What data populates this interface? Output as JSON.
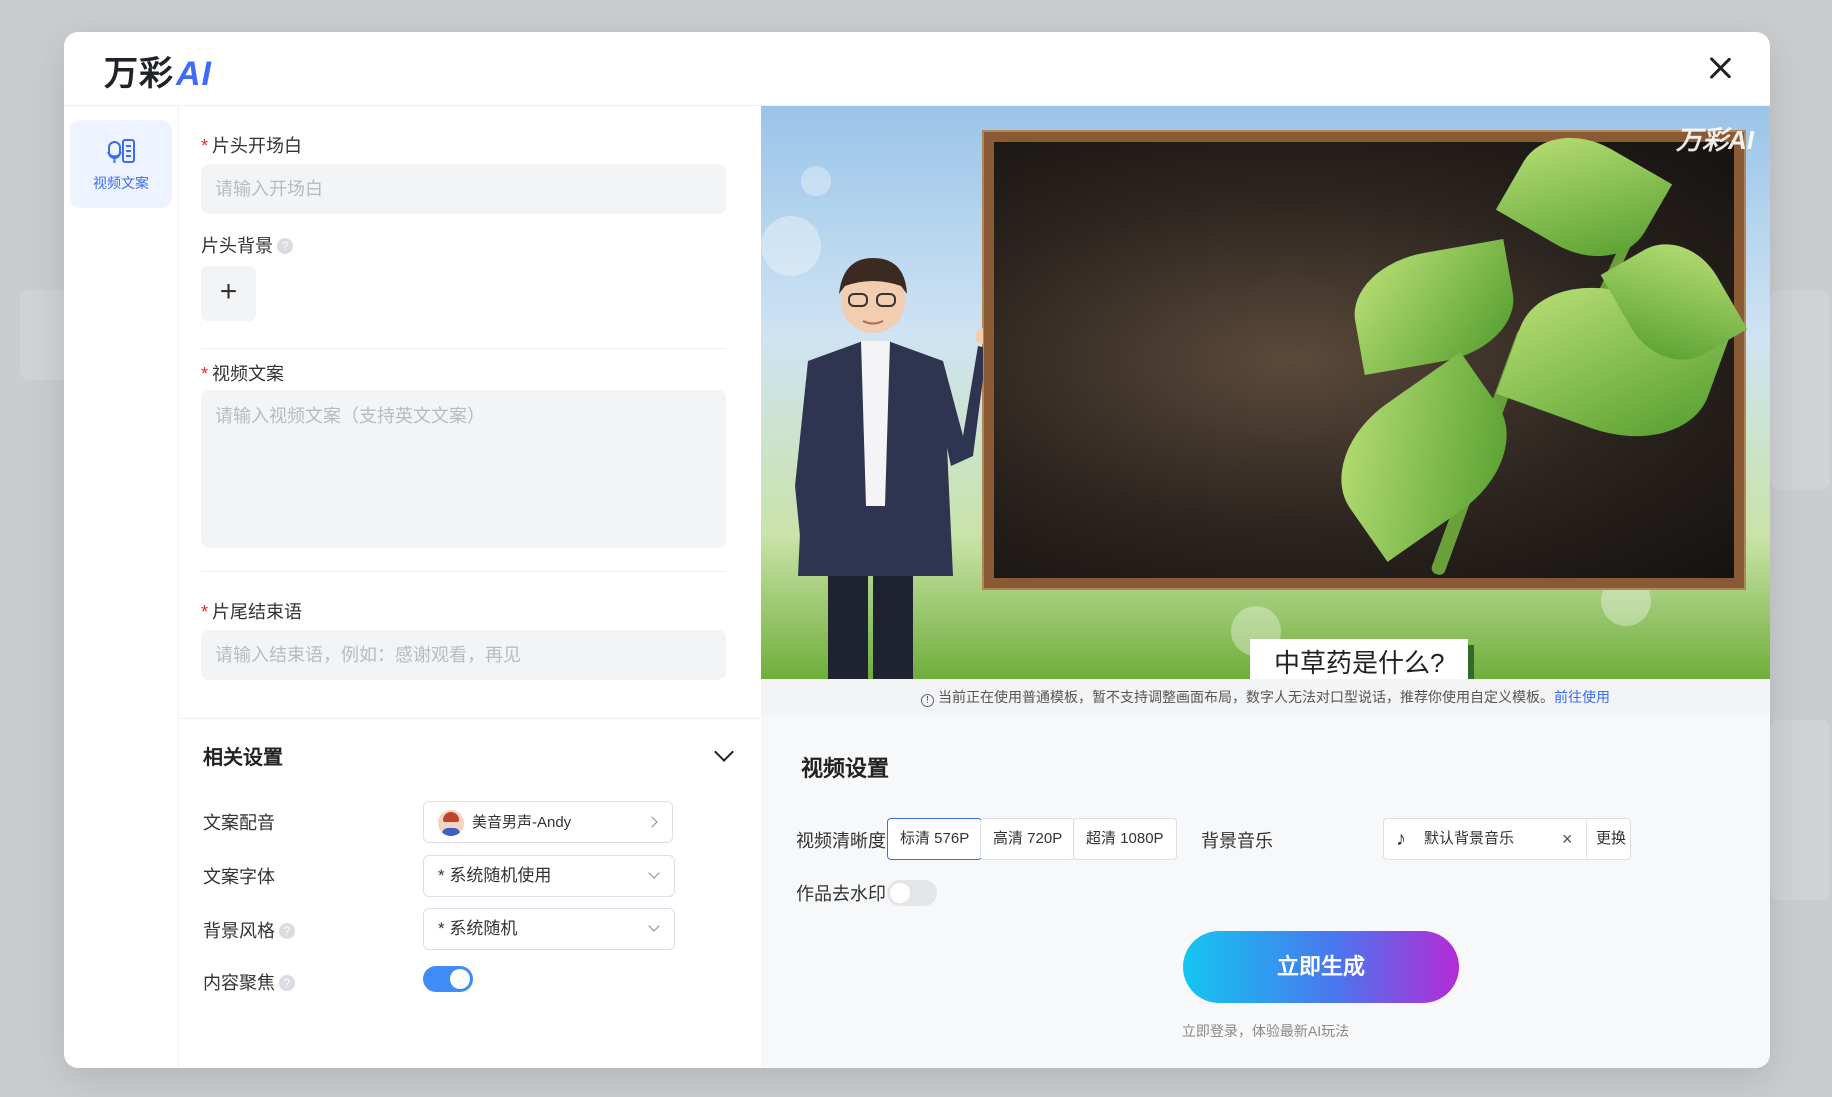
{
  "brand": {
    "name": "万彩",
    "suffix": "AI"
  },
  "rail": {
    "item_label": "视频文案"
  },
  "form": {
    "opening_label": "片头开场白",
    "opening_placeholder": "请输入开场白",
    "opening_bg_label": "片头背景",
    "script_label": "视频文案",
    "script_placeholder": "请输入视频文案（支持英文文案）",
    "ending_label": "片尾结束语",
    "ending_placeholder": "请输入结束语，例如：感谢观看，再见"
  },
  "settings": {
    "title": "相关设置",
    "voice_label": "文案配音",
    "voice_value": "美音男声-Andy",
    "font_label": "文案字体",
    "font_value": "* 系统随机使用",
    "bg_style_label": "背景风格",
    "bg_style_value": "* 系统随机",
    "focus_label": "内容聚焦",
    "focus_on": true
  },
  "preview": {
    "caption": "中草药是什么?",
    "watermark": "万彩AI"
  },
  "notice": {
    "text": "当前正在使用普通模板，暂不支持调整画面布局，数字人无法对口型说话，推荐你使用自定义模板。",
    "link": "前往使用"
  },
  "video_settings": {
    "title": "视频设置",
    "quality_label": "视频清晰度",
    "qualities": [
      "标清 576P",
      "高清 720P",
      "超清 1080P"
    ],
    "selected_quality": "标清 576P",
    "music_label": "背景音乐",
    "music_value": "默认背景音乐",
    "music_change": "更换",
    "watermark_label": "作品去水印",
    "watermark_on": false,
    "generate_label": "立即生成",
    "generate_hint": "立即登录，体验最新AI玩法"
  },
  "colors": {
    "accent": "#3a6df0",
    "toggle_on": "#3f8cf6",
    "required": "#f5222d"
  }
}
